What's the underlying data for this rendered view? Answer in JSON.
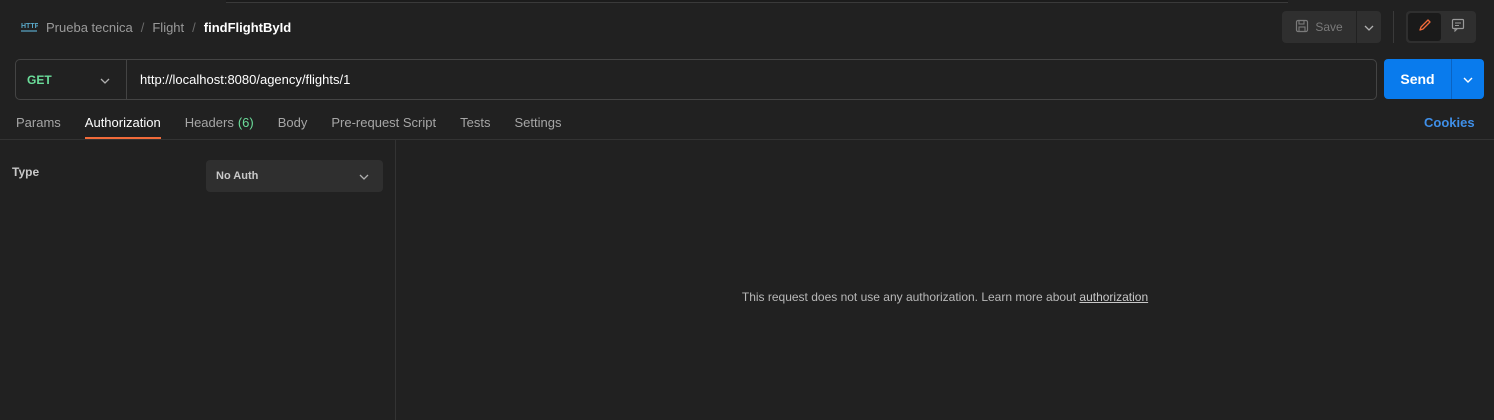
{
  "breadcrumb": {
    "icon": "http-icon",
    "items": [
      "Prueba tecnica",
      "Flight"
    ],
    "separator": "/",
    "current": "findFlightById"
  },
  "toolbar": {
    "save_label": "Save"
  },
  "request": {
    "method": "GET",
    "url": "http://localhost:8080/agency/flights/1",
    "send_label": "Send"
  },
  "tabs": [
    {
      "label": "Params",
      "active": false
    },
    {
      "label": "Authorization",
      "active": true
    },
    {
      "label": "Headers",
      "count": "(6)",
      "active": false
    },
    {
      "label": "Body",
      "active": false
    },
    {
      "label": "Pre-request Script",
      "active": false
    },
    {
      "label": "Tests",
      "active": false
    },
    {
      "label": "Settings",
      "active": false
    }
  ],
  "cookies_label": "Cookies",
  "auth": {
    "type_label": "Type",
    "selected": "No Auth",
    "message_prefix": "This request does not use any authorization. Learn more about ",
    "message_link": "authorization"
  },
  "colors": {
    "accent": "#097bed",
    "method_get": "#6bdd9a",
    "tab_active_underline": "#f26b3a",
    "link": "#3f8fe8"
  }
}
